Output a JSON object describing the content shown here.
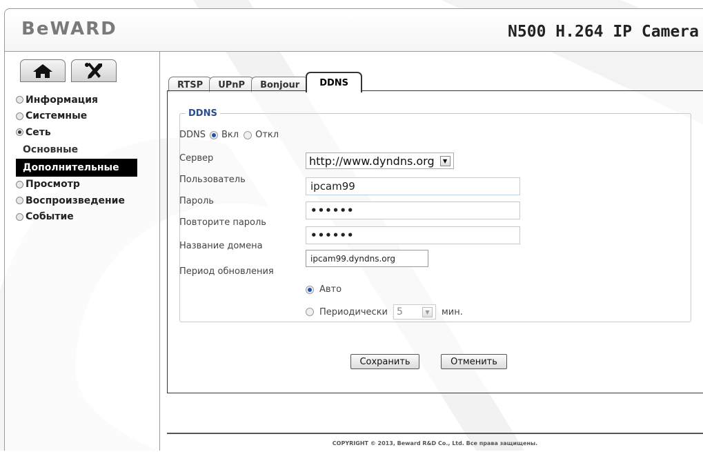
{
  "header": {
    "logo": "BeWARD",
    "product": "N500 H.264 IP Camera"
  },
  "toolbar": {
    "home_icon": "home-icon",
    "settings_icon": "tools-icon"
  },
  "sidebar": {
    "items": [
      {
        "label": "Информация",
        "selected": false
      },
      {
        "label": "Системные",
        "selected": false
      },
      {
        "label": "Сеть",
        "selected": true
      },
      {
        "label": "Просмотр",
        "selected": false
      },
      {
        "label": "Воспроизведение",
        "selected": false
      },
      {
        "label": "Событие",
        "selected": false
      }
    ],
    "network_sub": [
      {
        "label": "Основные",
        "active": false
      },
      {
        "label": "Дополнительные",
        "active": true
      }
    ]
  },
  "tabs": [
    {
      "label": "RTSP",
      "active": false
    },
    {
      "label": "UPnP",
      "active": false
    },
    {
      "label": "Bonjour",
      "active": false
    },
    {
      "label": "DDNS",
      "active": true
    }
  ],
  "ddns": {
    "legend": "DDNS",
    "enable_label": "DDNS",
    "on_label": "Вкл",
    "off_label": "Откл",
    "enabled": true,
    "server_label": "Сервер",
    "server_value": "http://www.dyndns.org",
    "user_label": "Пользователь",
    "user_value": "ipcam99",
    "password_label": "Пароль",
    "password_value": "••••••",
    "repeat_label": "Повторите пароль",
    "repeat_value": "••••••",
    "domain_label": "Название домена",
    "domain_value": "ipcam99.dyndns.org",
    "period_label": "Период обновления",
    "auto_label": "Авто",
    "periodic_label": "Периодически",
    "periodic_value": "5",
    "unit": "мин.",
    "mode": "auto"
  },
  "actions": {
    "save": "Сохранить",
    "cancel": "Отменить"
  },
  "footer": {
    "text": "COPYRIGHT © 2013, Beward R&D Co., Ltd. Все права защищены."
  },
  "colors": {
    "legend": "#2a4f8a",
    "radio_selected": "#2350b4"
  }
}
